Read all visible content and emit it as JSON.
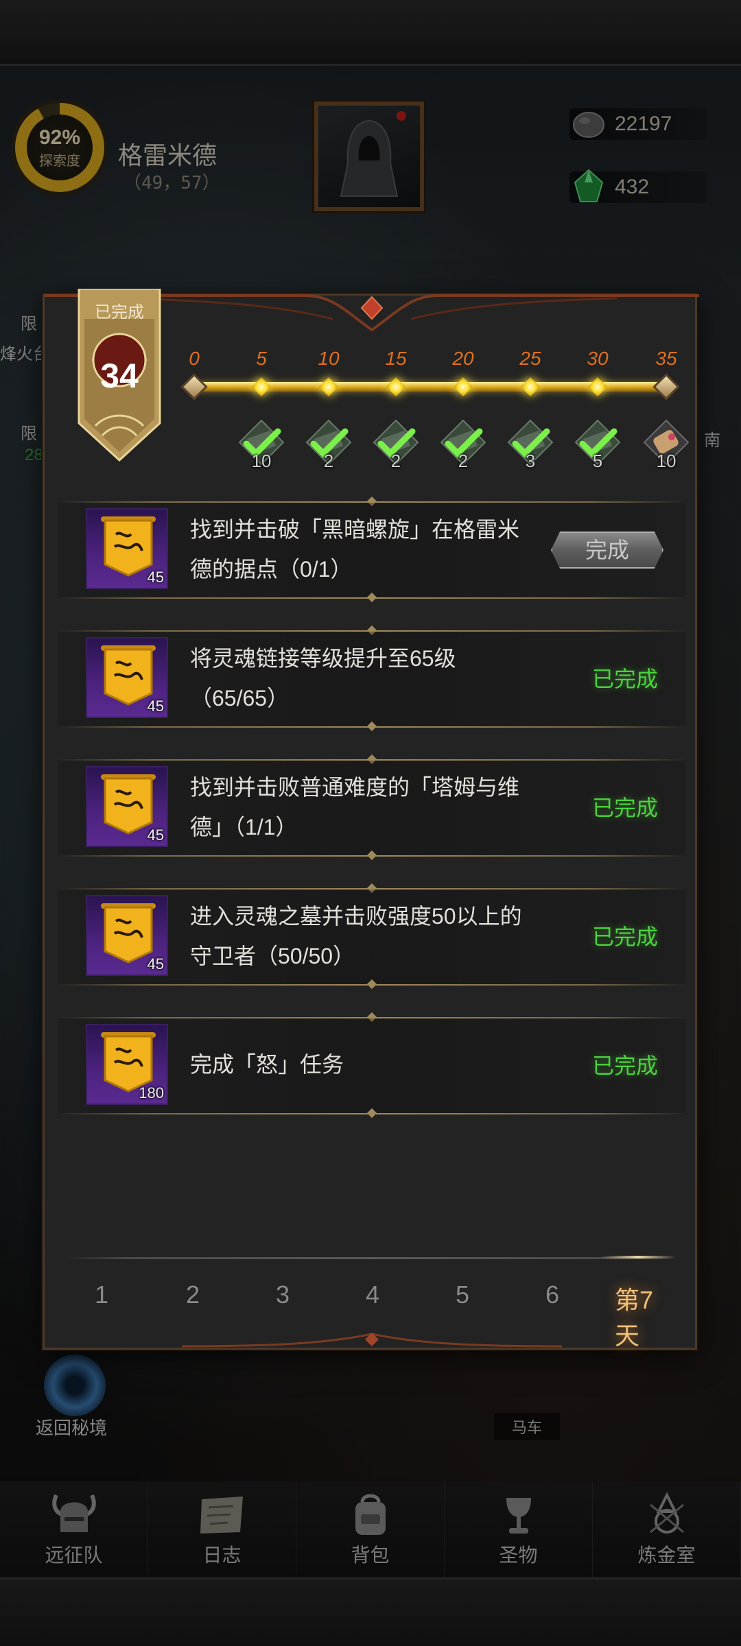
{
  "hud": {
    "explore_percent": "92%",
    "explore_label": "探索度",
    "location_name": "格雷米德",
    "location_coords": "（49，57）",
    "currency_a": "22197",
    "currency_b": "432",
    "currency_a_icon": "stone-icon",
    "currency_b_icon": "green-gem-icon"
  },
  "background": {
    "side_labels": [
      "限",
      "烽火台",
      "限",
      "南",
      "28"
    ],
    "return_label": "返回秘境",
    "cart_label": "马车"
  },
  "nav": {
    "items": [
      {
        "label": "远征队",
        "icon": "horned-helmet-icon"
      },
      {
        "label": "日志",
        "icon": "scroll-map-icon"
      },
      {
        "label": "背包",
        "icon": "backpack-icon"
      },
      {
        "label": "圣物",
        "icon": "chalice-icon"
      },
      {
        "label": "炼金室",
        "icon": "alchemy-icon"
      }
    ]
  },
  "panel": {
    "badge_title": "已完成",
    "badge_count": "34",
    "progress_current": 34,
    "progress_max": 35,
    "milestones": [
      "0",
      "5",
      "10",
      "15",
      "20",
      "25",
      "30",
      "35"
    ],
    "rewards": [
      {
        "qty": "10",
        "claimed": true
      },
      {
        "qty": "2",
        "claimed": true
      },
      {
        "qty": "2",
        "claimed": true
      },
      {
        "qty": "2",
        "claimed": true
      },
      {
        "qty": "3",
        "claimed": true
      },
      {
        "qty": "5",
        "claimed": true
      },
      {
        "qty": "10",
        "claimed": false
      }
    ],
    "quests": [
      {
        "points": "45",
        "text": "找到并击破「黑暗螺旋」在格雷米德的据点（0/1）",
        "status": "完成",
        "type": "button"
      },
      {
        "points": "45",
        "text": "将灵魂链接等级提升至65级（65/65）",
        "status": "已完成",
        "type": "done"
      },
      {
        "points": "45",
        "text": "找到并击败普通难度的「塔姆与维德」（1/1）",
        "status": "已完成",
        "type": "done"
      },
      {
        "points": "45",
        "text": "进入灵魂之墓并击败强度50以上的守卫者（50/50）",
        "status": "已完成",
        "type": "done"
      },
      {
        "points": "180",
        "text": "完成「怒」任务",
        "status": "已完成",
        "type": "done"
      }
    ],
    "days": [
      "1",
      "2",
      "3",
      "4",
      "5",
      "6",
      "第7天"
    ],
    "active_day_index": 6
  }
}
